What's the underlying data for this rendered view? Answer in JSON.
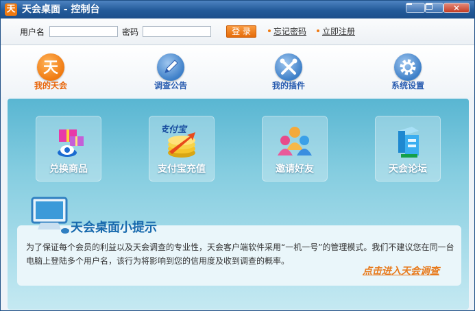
{
  "window": {
    "app_icon_glyph": "天",
    "title": "天会桌面 - 控制台",
    "buttons": {
      "minimize": "minimize-icon",
      "maximize": "maximize-icon",
      "close": "close-icon",
      "close_glyph": "✕"
    }
  },
  "login": {
    "username_label": "用户名",
    "username_value": "",
    "password_label": "密码",
    "password_value": "",
    "login_button": "登 录",
    "forgot_link": "忘记密码",
    "register_link": "立即注册"
  },
  "nav": {
    "items": [
      {
        "label": "我的天会",
        "icon": "tianhui-logo-icon",
        "active": true
      },
      {
        "label": "调查公告",
        "icon": "pencil-icon",
        "active": false
      },
      {
        "label": "我的插件",
        "icon": "tools-icon",
        "active": false
      },
      {
        "label": "系统设置",
        "icon": "gear-icon",
        "active": false
      }
    ]
  },
  "tiles": [
    {
      "label": "兑换商品",
      "icon": "gift-icon"
    },
    {
      "label": "支付宝充值",
      "icon": "alipay-coins-icon",
      "logo_text": "支付宝"
    },
    {
      "label": "邀请好友",
      "icon": "people-icon"
    },
    {
      "label": "天会论坛",
      "icon": "forum-icon"
    }
  ],
  "tips": {
    "title": "天会桌面小提示",
    "text": "为了保证每个会员的利益以及天会调查的专业性，天会客户端软件采用“一机一号”的管理模式。我们不建议您在同一台电脑上登陆多个用户名，该行为将影响到您的信用度及收到调查的概率。",
    "link": "点击进入天会调查"
  },
  "colors": {
    "accent": "#f07a11",
    "nav_blue": "#2a5db0",
    "panel": "#59b6d2",
    "title": "#235a99"
  }
}
